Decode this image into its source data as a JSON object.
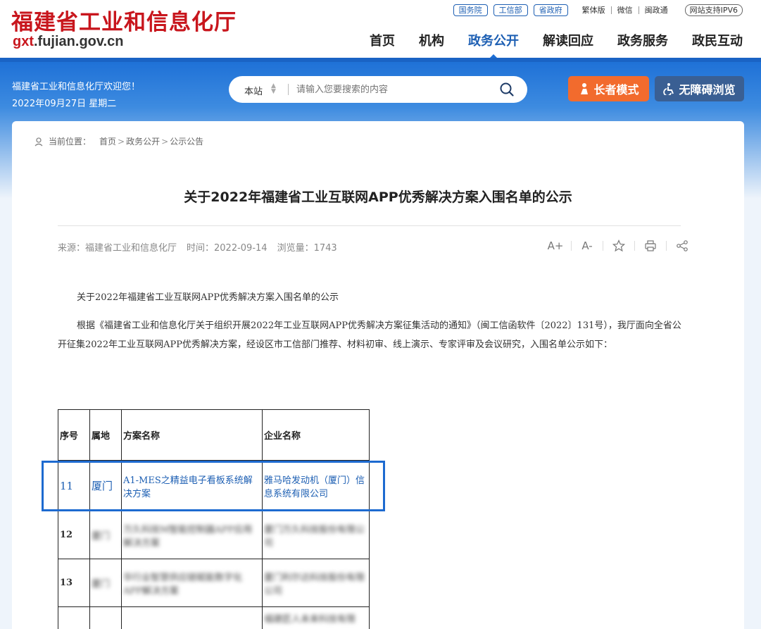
{
  "header": {
    "logo_cn": "福建省工业和信息化厅",
    "logo_url_pre": "gxt",
    "logo_url_post": ".fujian.gov.cn",
    "toplinks": {
      "pill1": "国务院",
      "pill2": "工信部",
      "pill3": "省政府",
      "traditional": "繁体版",
      "wechat": "微信",
      "minzheng": "闽政通",
      "ipv6": "网站支持IPV6"
    },
    "nav": [
      "首页",
      "机构",
      "政务公开",
      "解读回应",
      "政务服务",
      "政民互动"
    ],
    "nav_active_index": 2
  },
  "banner": {
    "welcome": "福建省工业和信息化厅欢迎您！",
    "date": "2022年09月27日 星期二",
    "search_scope": "本站",
    "search_placeholder": "请输入您要搜索的内容",
    "elder_mode": "长者模式",
    "accessible": "无障碍浏览"
  },
  "breadcrumb": {
    "label": "当前位置：",
    "items": [
      "首页",
      "政务公开",
      "公示公告"
    ]
  },
  "article": {
    "title": "关于2022年福建省工业互联网APP优秀解决方案入围名单的公示",
    "source": "来源：福建省工业和信息化厅",
    "time": "时间：2022-09-14",
    "views": "浏览量：1743",
    "tools": {
      "font_up": "A+",
      "font_down": "A-"
    },
    "p1": "关于2022年福建省工业互联网APP优秀解决方案入围名单的公示",
    "p2": "根据《福建省工业和信息化厅关于组织开展2022年工业互联网APP优秀解决方案征集活动的通知》（闽工信函软件〔2022〕131号），我厅面向全省公开征集2022年工业互联网APP优秀解决方案，经设区市工信部门推荐、材料初审、线上演示、专家评审及会议研究，入围名单公示如下："
  },
  "table": {
    "headers": [
      "序号",
      "属地",
      "方案名称",
      "企业名称"
    ],
    "rows": [
      {
        "no": "11",
        "region": "厦门",
        "solution": "A1-MES之精益电子看板系统解决方案",
        "company": "雅马哈发动机（厦门）信息系统有限公司"
      },
      {
        "no": "12",
        "region": "厦门",
        "solution": "万久科技M智能控制器APP应用解决方案",
        "company": "厦门万久科技股份有限公司"
      },
      {
        "no": "13",
        "region": "厦门",
        "solution": "华行业智慧供应链赋能数字化APP解决方案",
        "company": "厦门利尔达科技股份有限公司"
      },
      {
        "no": "",
        "region": "",
        "solution": "",
        "company": "福建匠人未来科技有限"
      }
    ]
  }
}
